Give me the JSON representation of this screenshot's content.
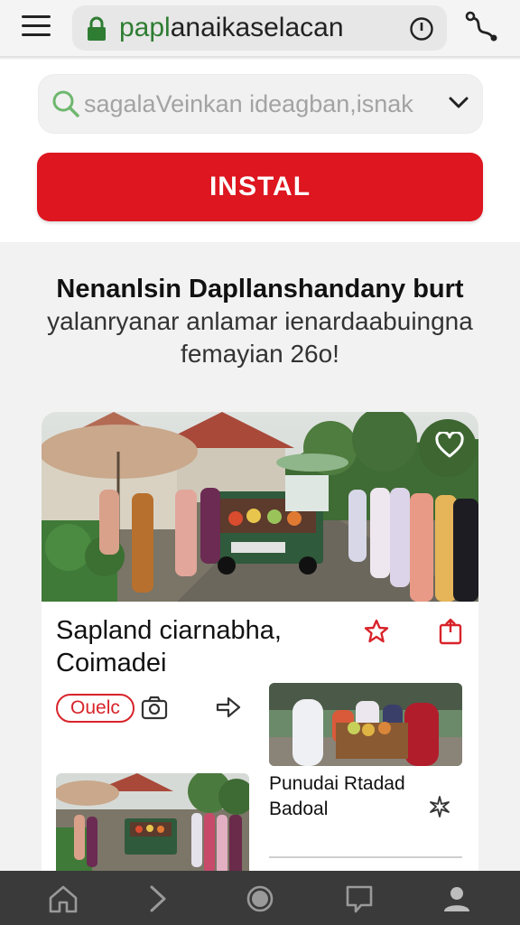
{
  "browser": {
    "url_highlight": "papl",
    "url_rest": "anaikaselacan"
  },
  "search": {
    "placeholder": "sagalaVeinkan ideagban,isnak"
  },
  "install": {
    "label": "INSTAL"
  },
  "headline": {
    "line1": "Nenanlsin Dapllanshandany burt",
    "line2": "yalanryanar anlamar ienardaabuingna",
    "line3": "femayian 26o!"
  },
  "card": {
    "title_line1": "Sapland ciarnabha,",
    "title_line2": "Coimadei",
    "tag": "Ouelc",
    "related": {
      "title_line1": "Punudai Rtadad",
      "title_line2": "Badoal"
    }
  },
  "colors": {
    "accent_red": "#dd1620",
    "lock_green": "#2e7d32",
    "nav_bar": "#3a3a3a"
  },
  "icons": [
    "menu-icon",
    "lock-icon",
    "info-icon",
    "route-icon",
    "search-icon",
    "chevron-down-icon",
    "heart-icon",
    "star-icon",
    "share-icon",
    "camera-icon",
    "arrow-right-icon",
    "sparkle-icon",
    "home-icon",
    "forward-icon",
    "circle-icon",
    "chat-icon",
    "profile-icon"
  ]
}
